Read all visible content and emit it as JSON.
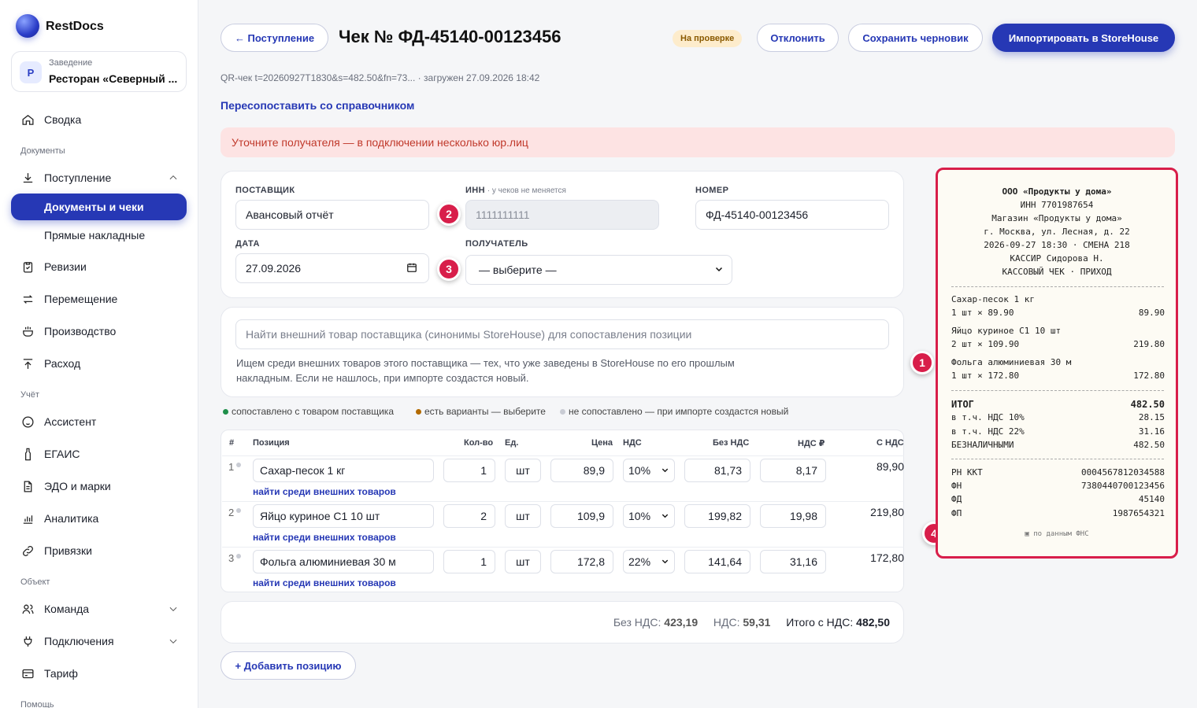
{
  "sidebar": {
    "brand": "RestDocs",
    "venue": {
      "avatar": "Р",
      "label": "Заведение",
      "name": "Ресторан «Северный ..."
    },
    "nav": {
      "summary": "Сводка",
      "section_docs": "Документы",
      "incoming": "Поступление",
      "docs_checks": "Документы и чеки",
      "direct_invoices": "Прямые накладные",
      "revisions": "Ревизии",
      "transfer": "Перемещение",
      "production": "Производство",
      "expense": "Расход",
      "section_accounting": "Учёт",
      "assistant": "Ассистент",
      "egais": "ЕГАИС",
      "edo": "ЭДО и марки",
      "analytics": "Аналитика",
      "bindings": "Привязки",
      "section_object": "Объект",
      "team": "Команда",
      "connections": "Подключения",
      "tariff": "Тариф",
      "section_help": "Помощь"
    }
  },
  "header": {
    "back_label": "← Поступление",
    "title": "Чек № ФД-45140-00123456",
    "status": "На проверке",
    "reject_label": "Отклонить",
    "save_draft_label": "Сохранить черновик",
    "import_label": "Импортировать в StoreHouse"
  },
  "meta": "QR-чек t=20260927T1830&s=482.50&fn=73... · загружен 27.09.2026 18:42",
  "remap_link": "Пересопоставить со справочником",
  "alert": "Уточните получателя — в подключении несколько юр.лиц",
  "form": {
    "supplier_label": "ПОСТАВЩИК",
    "supplier_value": "Авансовый отчёт",
    "inn_label": "ИНН",
    "inn_note": " · у чеков не меняется",
    "inn_value": "1111111111",
    "number_label": "НОМЕР",
    "number_value": "ФД-45140-00123456",
    "date_label": "ДАТА",
    "date_value": "27.09.2026",
    "recipient_label": "ПОЛУЧАТЕЛЬ",
    "recipient_value": "— выберите —"
  },
  "markers": [
    "1",
    "2",
    "3",
    "4"
  ],
  "search": {
    "placeholder": "Найти внешний товар поставщика (синонимы StoreHouse) для сопоставления позиции",
    "hint": "Ищем среди внешних товаров этого поставщика — тех, что уже заведены в StoreHouse по его прошлым накладным. Если не нашлось, при импорте создастся новый."
  },
  "legend": {
    "matched": "сопоставлено с товаром поставщика",
    "variants": "есть варианты — выберите",
    "unmatched": "не сопоставлено — при импорте создастся новый",
    "colors": {
      "matched": "#1f8f4a",
      "variants": "#b26a00",
      "unmatched": "#c9ccd4"
    }
  },
  "table": {
    "headers": [
      "#",
      "Позиция",
      "Кол-во",
      "Ед.",
      "Цена",
      "НДС",
      "Без НДС",
      "НДС ₽",
      "С НДС"
    ],
    "find_link": "найти среди внешних товаров",
    "rows": [
      {
        "n": "1",
        "name": "Сахар-песок 1 кг",
        "qty": "1",
        "unit": "шт",
        "price": "89,9",
        "vat": "10%",
        "net": "81,73",
        "vat_sum": "8,17",
        "gross": "89,90"
      },
      {
        "n": "2",
        "name": "Яйцо куриное С1 10 шт",
        "qty": "2",
        "unit": "шт",
        "price": "109,9",
        "vat": "10%",
        "net": "199,82",
        "vat_sum": "19,98",
        "gross": "219,80"
      },
      {
        "n": "3",
        "name": "Фольга алюминиевая 30 м",
        "qty": "1",
        "unit": "шт",
        "price": "172,8",
        "vat": "22%",
        "net": "141,64",
        "vat_sum": "31,16",
        "gross": "172,80"
      }
    ]
  },
  "totals": {
    "net_label": "Без НДС:",
    "net": "423,19",
    "vat_label": "НДС:",
    "vat": "59,31",
    "gross_label": "Итого с НДС:",
    "gross": "482,50"
  },
  "add_position": "+ Добавить позицию",
  "receipt": {
    "org": "ООО «Продукты у дома»",
    "inn": "ИНН 7701987654",
    "shop": "Магазин «Продукты у дома»",
    "address": "г. Москва, ул. Лесная, д. 22",
    "datetime": "2026-09-27 18:30 · СМЕНА 218",
    "cashier": "КАССИР Сидорова Н.",
    "type": "КАССОВЫЙ ЧЕК · ПРИХОД",
    "items": [
      {
        "name": "Сахар-песок 1 кг",
        "calc": "1 шт × 89.90",
        "sum": "89.90"
      },
      {
        "name": "Яйцо куриное С1 10 шт",
        "calc": "2 шт × 109.90",
        "sum": "219.80"
      },
      {
        "name": "Фольга алюминиевая 30 м",
        "calc": "1 шт × 172.80",
        "sum": "172.80"
      }
    ],
    "total_label": "ИТОГ",
    "total": "482.50",
    "vat10_label": "в т.ч. НДС 10%",
    "vat10": "28.15",
    "vat22_label": "в т.ч. НДС 22%",
    "vat22": "31.16",
    "cashless_label": "БЕЗНАЛИЧНЫМИ",
    "cashless": "482.50",
    "rn_label": "РН ККТ",
    "rn": "0004567812034588",
    "fn_label": "ФН",
    "fn": "7380440700123456",
    "fd_label": "ФД",
    "fd": "45140",
    "fp_label": "ФП",
    "fp": "1987654321",
    "footer": "▣ по данным ФНС"
  }
}
